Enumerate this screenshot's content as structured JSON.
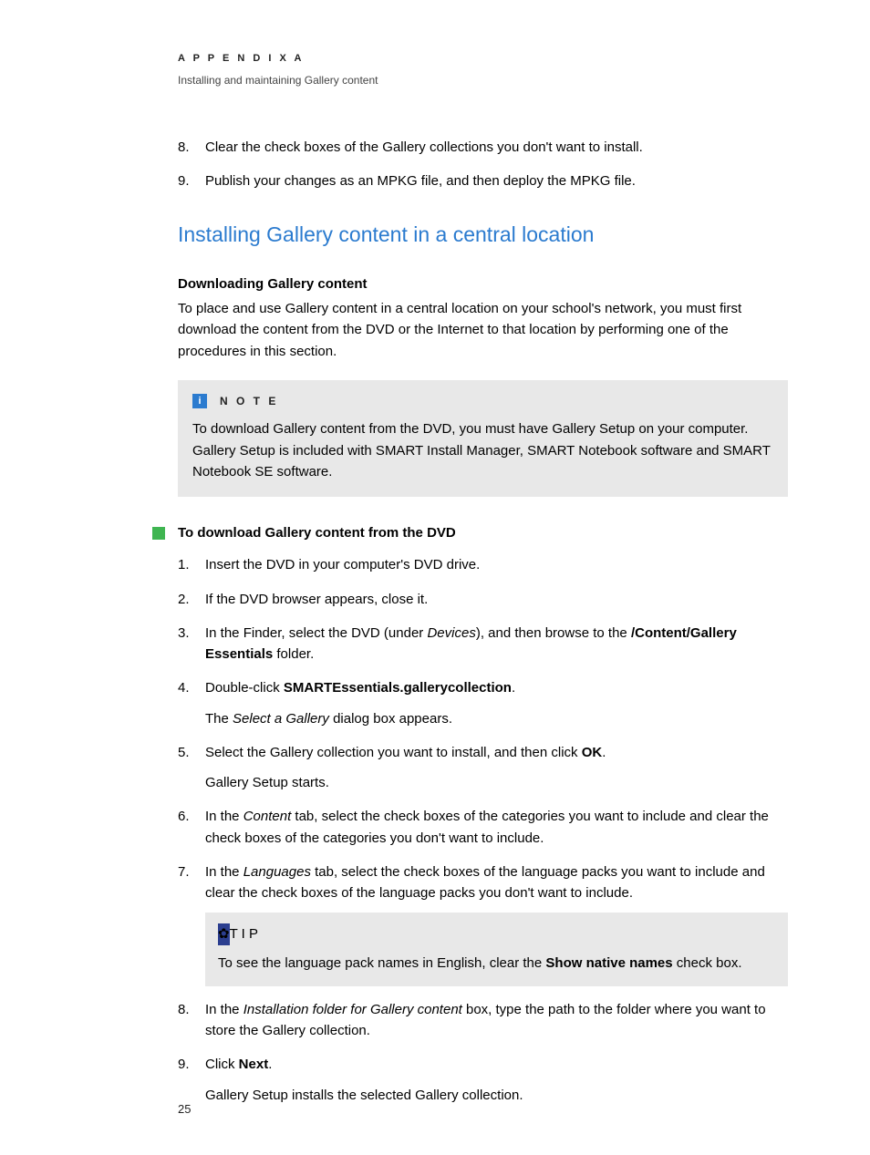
{
  "header": {
    "appendix": "A P P E N D I X   A",
    "subtitle": "Installing and maintaining Gallery content"
  },
  "topList": {
    "item8_num": "8.",
    "item8": "Clear the check boxes of the Gallery collections you don't want to install.",
    "item9_num": "9.",
    "item9": "Publish your changes as an MPKG file, and then deploy the MPKG file."
  },
  "sectionTitle": "Installing Gallery content in a central location",
  "download": {
    "heading": "Downloading Gallery content",
    "para": "To place and use Gallery content in a central location on your school's network, you must first download the content from the DVD or the Internet to that location by performing one of the procedures in this section."
  },
  "note": {
    "label": "N O T E",
    "body": "To download Gallery content from the DVD, you must have Gallery Setup on your computer. Gallery Setup is included with SMART Install Manager, SMART Notebook software and SMART Notebook SE software."
  },
  "procTitle": "To download Gallery content from the DVD",
  "steps": {
    "s1_num": "1.",
    "s1": "Insert the DVD in your computer's DVD drive.",
    "s2_num": "2.",
    "s2": "If the DVD browser appears, close it.",
    "s3_num": "3.",
    "s3_a": "In the Finder, select the DVD (under ",
    "s3_i": "Devices",
    "s3_b": "), and then browse to the ",
    "s3_bold": "/Content/Gallery Essentials",
    "s3_c": " folder.",
    "s4_num": "4.",
    "s4_a": "Double-click ",
    "s4_bold": "SMARTEssentials.gallerycollection",
    "s4_b": ".",
    "s4_sub_a": "The ",
    "s4_sub_i": "Select a Gallery",
    "s4_sub_b": " dialog box appears.",
    "s5_num": "5.",
    "s5_a": "Select the Gallery collection you want to install, and then click ",
    "s5_bold": "OK",
    "s5_b": ".",
    "s5_sub": "Gallery Setup starts.",
    "s6_num": "6.",
    "s6_a": "In the ",
    "s6_i": "Content",
    "s6_b": " tab, select the check boxes of the categories you want to include and clear the check boxes of the categories you don't want to include.",
    "s7_num": "7.",
    "s7_a": "In the ",
    "s7_i": "Languages",
    "s7_b": " tab, select the check boxes of the language packs you want to include and clear the check boxes of the language packs you don't want to include.",
    "tip_label": "T I P",
    "tip_a": "To see the language pack names in English, clear the ",
    "tip_bold": "Show native names",
    "tip_b": " check box.",
    "s8_num": "8.",
    "s8_a": "In the ",
    "s8_i": "Installation folder for Gallery content",
    "s8_b": " box, type the path to the folder where you want to store the Gallery collection.",
    "s9_num": "9.",
    "s9_a": "Click ",
    "s9_bold": "Next",
    "s9_b": ".",
    "s9_sub": "Gallery Setup installs the selected Gallery collection."
  },
  "pageNumber": "25"
}
